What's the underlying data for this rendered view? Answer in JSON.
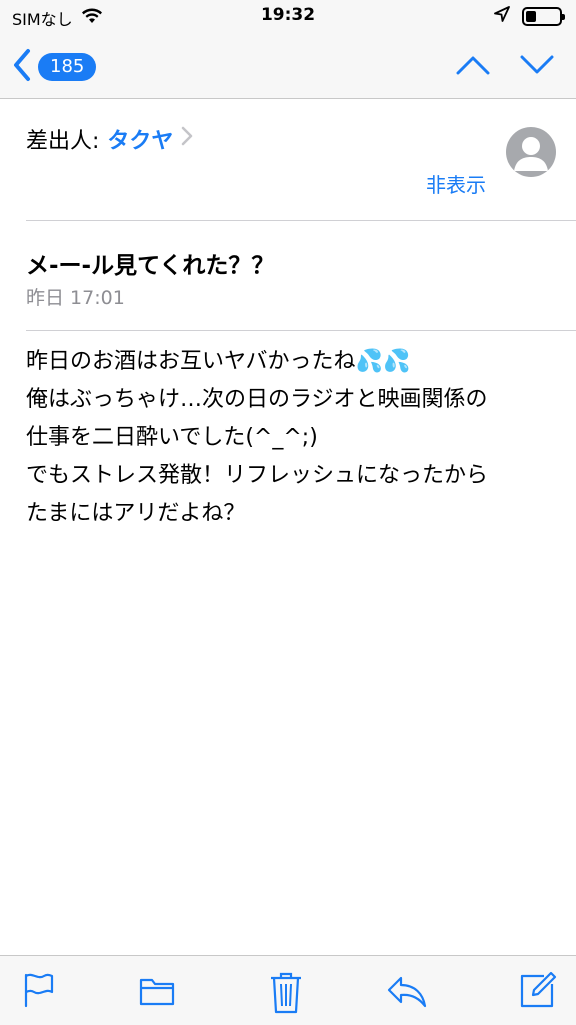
{
  "status": {
    "carrier": "SIMなし",
    "time": "19:32"
  },
  "nav": {
    "unread_count": "185"
  },
  "sender": {
    "label": "差出人:",
    "name": "タクヤ",
    "hide_link": "非表示"
  },
  "message": {
    "subject": "メ-ー-ル見てくれた？？",
    "date": "昨日 17:01",
    "body_lines": [
      "昨日のお酒はお互いヤバかったね💦💦",
      "俺はぶっちゃけ…次の日のラジオと映画関係の",
      "仕事を二日酔いでした(^_^;)",
      "でもストレス発散！リフレッシュになったから",
      "たまにはアリだよね？"
    ]
  },
  "colors": {
    "accent": "#1a7cf5",
    "secondary_text": "#8e8e93",
    "bar_background": "#f7f7f7"
  },
  "icons": [
    "wifi-icon",
    "location-icon",
    "battery-icon",
    "back-chevron-icon",
    "up-arrow-icon",
    "down-arrow-icon",
    "chevron-right-icon",
    "avatar-icon",
    "flag-icon",
    "folder-icon",
    "trash-icon",
    "reply-icon",
    "compose-icon"
  ]
}
